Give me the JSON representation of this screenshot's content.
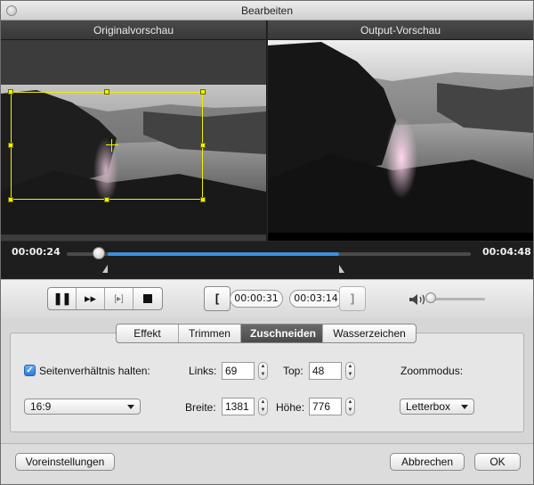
{
  "window": {
    "title": "Bearbeiten"
  },
  "preview": {
    "original_label": "Originalvorschau",
    "output_label": "Output-Vorschau"
  },
  "timeline": {
    "current_time": "00:00:24",
    "total_time": "00:04:48",
    "progress": 0.08
  },
  "controls": {
    "start_time": "00:00:31",
    "end_time": "00:03:14",
    "volume": 0.05,
    "icons": [
      "pause-icon",
      "fast-forward-icon",
      "snapshot-icon",
      "stop-icon",
      "mark-in-icon",
      "mark-out-icon",
      "speaker-icon"
    ]
  },
  "tabs": [
    {
      "label": "Effekt"
    },
    {
      "label": "Trimmen"
    },
    {
      "label": "Zuschneiden"
    },
    {
      "label": "Wasserzeichen"
    }
  ],
  "crop": {
    "keep_ratio_label": "Seitenverhältnis halten:",
    "keep_ratio_checked": true,
    "aspect_value": "16:9",
    "left_label": "Links:",
    "left_value": "69",
    "top_label": "Top:",
    "top_value": "48",
    "width_label": "Breite:",
    "width_value": "1381",
    "height_label": "Höhe:",
    "height_value": "776",
    "zoom_label": "Zoommodus:",
    "zoom_value": "Letterbox"
  },
  "footer": {
    "presets_label": "Voreinstellungen",
    "cancel_label": "Abbrechen",
    "ok_label": "OK"
  },
  "colors": {
    "accent": "#3c8ee0",
    "crop_frame": "#f0f000"
  }
}
